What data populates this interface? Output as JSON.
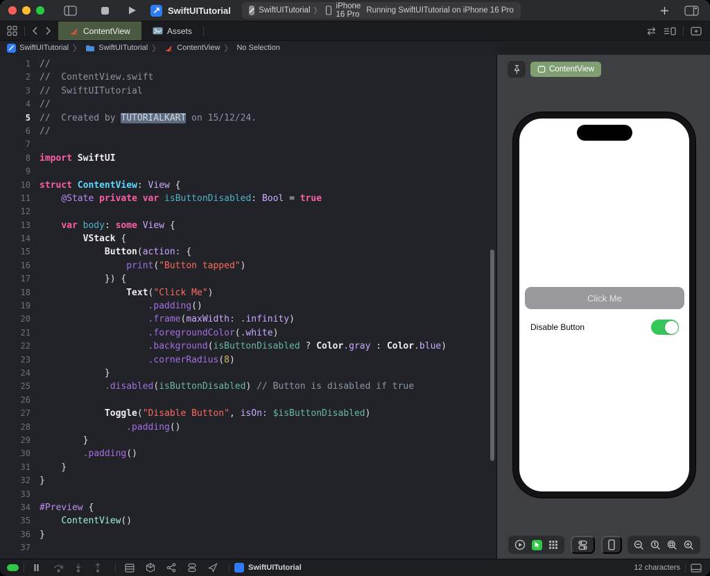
{
  "window": {
    "title": "SwiftUITutorial"
  },
  "toolbar": {
    "scheme_project": "SwiftUITutorial",
    "scheme_device": "iPhone 16 Pro",
    "status": "Running SwiftUITutorial on iPhone 16 Pro",
    "icons": [
      "sidebar-toggle",
      "stop",
      "run",
      "plus",
      "inspector-toggle"
    ]
  },
  "tabbar": {
    "tabs": [
      {
        "label": "ContentView",
        "active": true
      },
      {
        "label": "Assets",
        "active": false
      }
    ],
    "icons": [
      "tab-overview",
      "back-chevron",
      "forward-chevron",
      "related-items",
      "editor-options",
      "add-editor"
    ]
  },
  "breadcrumb": {
    "items": [
      "SwiftUITutorial",
      "SwiftUITutorial",
      "ContentView",
      "No Selection"
    ]
  },
  "editor": {
    "current_line": 5,
    "lines": [
      [
        [
          "c",
          "//"
        ]
      ],
      [
        [
          "c",
          "//  ContentView.swift"
        ]
      ],
      [
        [
          "c",
          "//  SwiftUITutorial"
        ]
      ],
      [
        [
          "c",
          "//"
        ]
      ],
      [
        [
          "c",
          "//  Created by "
        ],
        [
          "sel",
          "TUTORIALKART"
        ],
        [
          "c",
          " on 15/12/24."
        ]
      ],
      [
        [
          "c",
          "//"
        ]
      ],
      [],
      [
        [
          "k",
          "import"
        ],
        [
          "x",
          " "
        ],
        [
          "w",
          "SwiftUI"
        ]
      ],
      [],
      [
        [
          "k",
          "struct"
        ],
        [
          "x",
          " "
        ],
        [
          "d",
          "ContentView"
        ],
        [
          "x",
          ": "
        ],
        [
          "t",
          "View"
        ],
        [
          "x",
          " {"
        ]
      ],
      [
        [
          "x",
          "    "
        ],
        [
          "a",
          "@State"
        ],
        [
          "x",
          " "
        ],
        [
          "k",
          "private"
        ],
        [
          "x",
          " "
        ],
        [
          "k",
          "var"
        ],
        [
          "x",
          " "
        ],
        [
          "v",
          "isButtonDisabled"
        ],
        [
          "x",
          ": "
        ],
        [
          "t",
          "Bool"
        ],
        [
          "x",
          " = "
        ],
        [
          "k",
          "true"
        ]
      ],
      [],
      [
        [
          "x",
          "    "
        ],
        [
          "k",
          "var"
        ],
        [
          "x",
          " "
        ],
        [
          "v",
          "body"
        ],
        [
          "x",
          ": "
        ],
        [
          "k",
          "some"
        ],
        [
          "x",
          " "
        ],
        [
          "t",
          "View"
        ],
        [
          "x",
          " {"
        ]
      ],
      [
        [
          "x",
          "        "
        ],
        [
          "w",
          "VStack"
        ],
        [
          "x",
          " {"
        ]
      ],
      [
        [
          "x",
          "            "
        ],
        [
          "w",
          "Button"
        ],
        [
          "x",
          "("
        ],
        [
          "t",
          "action:"
        ],
        [
          "x",
          " {"
        ]
      ],
      [
        [
          "x",
          "                "
        ],
        [
          "f",
          "print"
        ],
        [
          "x",
          "("
        ],
        [
          "s",
          "\"Button tapped\""
        ],
        [
          "x",
          ")"
        ]
      ],
      [
        [
          "x",
          "            }) {"
        ]
      ],
      [
        [
          "x",
          "                "
        ],
        [
          "w",
          "Text"
        ],
        [
          "x",
          "("
        ],
        [
          "s",
          "\"Click Me\""
        ],
        [
          "x",
          ")"
        ]
      ],
      [
        [
          "x",
          "                    "
        ],
        [
          "f",
          ".padding"
        ],
        [
          "x",
          "()"
        ]
      ],
      [
        [
          "x",
          "                    "
        ],
        [
          "f",
          ".frame"
        ],
        [
          "x",
          "("
        ],
        [
          "t",
          "maxWidth:"
        ],
        [
          "x",
          " "
        ],
        [
          "t",
          ".infinity"
        ],
        [
          "x",
          ")"
        ]
      ],
      [
        [
          "x",
          "                    "
        ],
        [
          "f",
          ".foregroundColor"
        ],
        [
          "x",
          "("
        ],
        [
          "t",
          ".white"
        ],
        [
          "x",
          ")"
        ]
      ],
      [
        [
          "x",
          "                    "
        ],
        [
          "f",
          ".background"
        ],
        [
          "x",
          "("
        ],
        [
          "p",
          "isButtonDisabled"
        ],
        [
          "x",
          " ? "
        ],
        [
          "w",
          "Color"
        ],
        [
          "t",
          ".gray"
        ],
        [
          "x",
          " : "
        ],
        [
          "w",
          "Color"
        ],
        [
          "t",
          ".blue"
        ],
        [
          "x",
          ")"
        ]
      ],
      [
        [
          "x",
          "                    "
        ],
        [
          "f",
          ".cornerRadius"
        ],
        [
          "x",
          "("
        ],
        [
          "n",
          "8"
        ],
        [
          "x",
          ")"
        ]
      ],
      [
        [
          "x",
          "            }"
        ]
      ],
      [
        [
          "x",
          "            "
        ],
        [
          "f",
          ".disabled"
        ],
        [
          "x",
          "("
        ],
        [
          "p",
          "isButtonDisabled"
        ],
        [
          "x",
          ") "
        ],
        [
          "c",
          "// Button is disabled if true"
        ]
      ],
      [],
      [
        [
          "x",
          "            "
        ],
        [
          "w",
          "Toggle"
        ],
        [
          "x",
          "("
        ],
        [
          "s",
          "\"Disable Button\""
        ],
        [
          "x",
          ", "
        ],
        [
          "t",
          "isOn:"
        ],
        [
          "x",
          " "
        ],
        [
          "p",
          "$isButtonDisabled"
        ],
        [
          "x",
          ")"
        ]
      ],
      [
        [
          "x",
          "                "
        ],
        [
          "f",
          ".padding"
        ],
        [
          "x",
          "()"
        ]
      ],
      [
        [
          "x",
          "        }"
        ]
      ],
      [
        [
          "x",
          "        "
        ],
        [
          "f",
          ".padding"
        ],
        [
          "x",
          "()"
        ]
      ],
      [
        [
          "x",
          "    }"
        ]
      ],
      [
        [
          "x",
          "}"
        ]
      ],
      [],
      [
        [
          "a",
          "#Preview"
        ],
        [
          "x",
          " {"
        ]
      ],
      [
        [
          "x",
          "    "
        ],
        [
          "m",
          "ContentView"
        ],
        [
          "x",
          "()"
        ]
      ],
      [
        [
          "x",
          "}"
        ]
      ],
      []
    ]
  },
  "preview": {
    "tab_label": "ContentView",
    "phone": {
      "button_label": "Click Me",
      "toggle_label": "Disable Button",
      "toggle_on": true,
      "button_color": "#98989d",
      "toggle_color": "#35c759"
    },
    "toolbar_icons": [
      "play-circle",
      "live-preview",
      "variants-grid",
      "device-settings",
      "device",
      "zoom-out",
      "zoom-100",
      "zoom-fit",
      "zoom-in"
    ]
  },
  "statusbar": {
    "project": "SwiftUITutorial",
    "characters": "12 characters",
    "icons": [
      "breakpoints-toggle",
      "pause",
      "step-over",
      "step-into",
      "step-out",
      "view-hierarchy",
      "memory-graph",
      "environment-overrides",
      "appearance",
      "simulate-location",
      "console-toggle"
    ]
  },
  "colors": {
    "accent_green": "#31c848",
    "tab_active": "#4a5a40",
    "swift_orange": "#f05138",
    "editor_bg": "#222329"
  }
}
